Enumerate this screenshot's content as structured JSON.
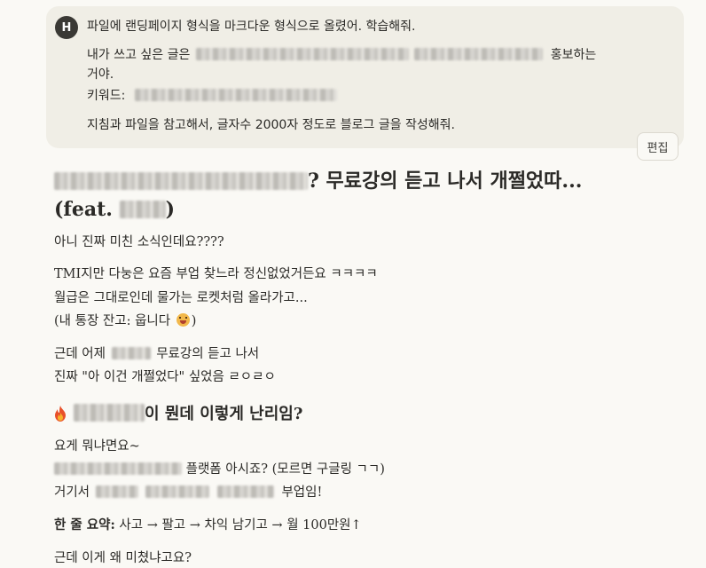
{
  "user_message": {
    "avatar_initial": "H",
    "line1": "파일에 랜딩페이지 형식을 마크다운 형식으로 올렸어. 학습해줘.",
    "line2_prefix": "내가 쓰고 싶은 글은",
    "line2_suffix": "홍보하는",
    "line3": "거야.",
    "line4_prefix": "키워드:",
    "line5": "지침과 파일을 참고해서, 글자수 2000자 정도로 블로그 글을 작성해줘."
  },
  "edit_button_label": "편집",
  "response": {
    "title_part1": "? 무료강의 듣고 나서 개쩔었따...",
    "title_part2_prefix": "(feat.",
    "title_part2_suffix": ")",
    "p1": "아니 진짜 미친 소식인데요????",
    "p2_l1": "TMI지만 다눙은 요즘 부업 찾느라 정신없었거든요 ㅋㅋㅋㅋ",
    "p2_l2": "월급은 그대로인데 물가는 로켓처럼 올라가고...",
    "p2_l3_prefix": "(내 통장 잔고: 웁니다",
    "p2_l3_suffix": ")",
    "p3_l1_prefix": "근데 어제",
    "p3_l1_suffix": "무료강의 듣고 나서",
    "p3_l2": "진짜 \"아 이건 개쩔었다\" 싶었음 ㄹㅇㄹㅇ",
    "h2_suffix": "이 뭔데 이렇게 난리임?",
    "p4": "요게 뭐냐면요~",
    "p5_suffix": "플랫폼 아시죠? (모르면 구글링 ㄱㄱ)",
    "p6_prefix": "거기서",
    "p6_suffix": "부업임!",
    "summary_label": "한 줄 요약:",
    "summary_text": "사고 → 팔고 → 차익 남기고 → 월 100만원↑",
    "p8": "근데 이게 왜 미쳤냐고요?"
  },
  "icons": {
    "fire": "fire-icon",
    "face": "melting-face-emoji"
  },
  "colors": {
    "background": "#faf9f5",
    "user_bubble": "#f0eee6",
    "avatar": "#3a3935",
    "text": "#2b2a27"
  }
}
